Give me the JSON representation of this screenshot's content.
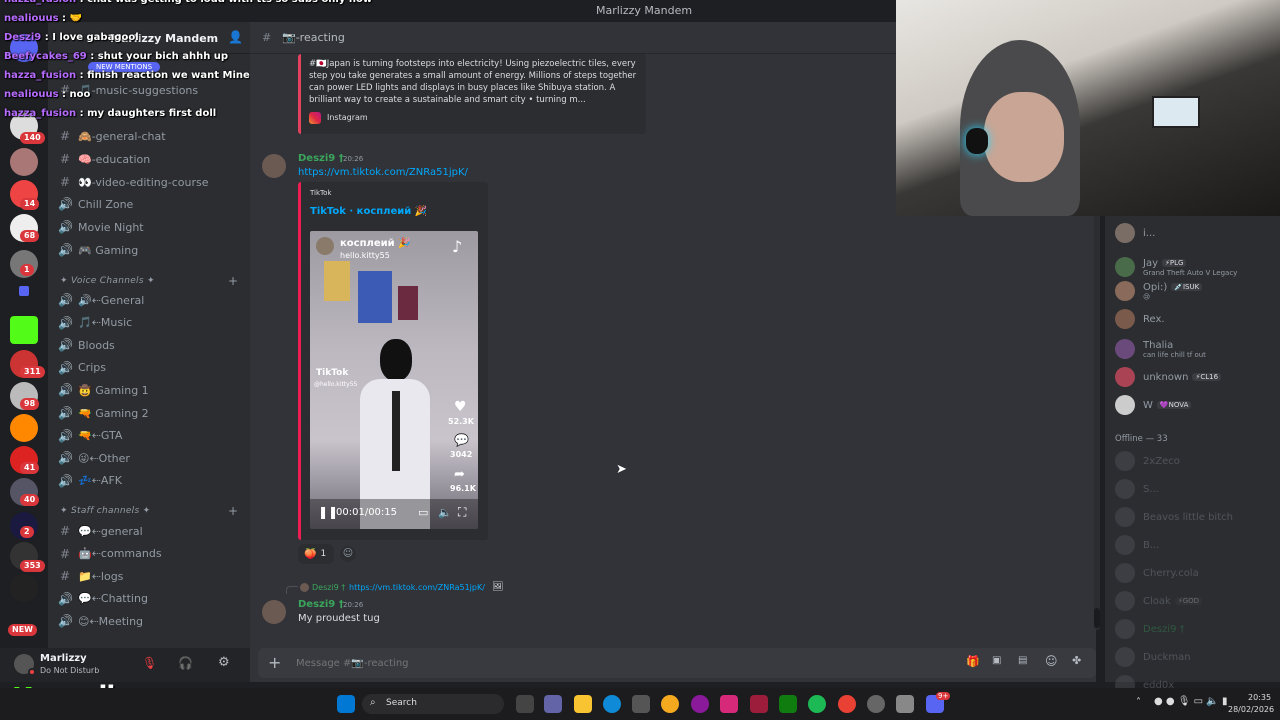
{
  "window": {
    "title": "Marlizzy Mandem"
  },
  "overlay_chat": [
    {
      "user": "hazza_fusion",
      "text": "chat was getting to loud with tts so subs only now"
    },
    {
      "user": "nealiouus",
      "text": "🤝"
    },
    {
      "user": "Deszi9",
      "text": "I love gabagool"
    },
    {
      "user": "Beefycakes_69",
      "text": "shut your bich ahhh up"
    },
    {
      "user": "hazza_fusion",
      "text": "finish reaction we want Minecraft"
    },
    {
      "user": "nealiouus",
      "text": "noo"
    },
    {
      "user": "hazza_fusion",
      "text": "my daughters first doll"
    }
  ],
  "guilds": {
    "badges": [
      "140",
      "14",
      "68",
      "1",
      "311",
      "98",
      "41",
      "40",
      "2",
      "353"
    ],
    "new_label": "NEW"
  },
  "sidebar": {
    "server_name": "Marlizzy Mandem",
    "new_mentions": "NEW MENTIONS",
    "text_channels": [
      {
        "icon": "#",
        "label": "🎵-music-suggestions"
      },
      {
        "icon": "#",
        "label": "🙈-general-chat"
      },
      {
        "icon": "#",
        "label": "🧠-education"
      },
      {
        "icon": "#",
        "label": "👀-video-editing-course"
      },
      {
        "icon": "🔊",
        "label": "Chill Zone"
      },
      {
        "icon": "🔊",
        "label": "Movie Night"
      },
      {
        "icon": "🔊",
        "label": "🎮 Gaming"
      }
    ],
    "voice_category": "✦ Voice Channels ✦",
    "voice_channels": [
      {
        "label": "🔊⇠General"
      },
      {
        "label": "🎵⇠Music"
      },
      {
        "label": "Bloods"
      },
      {
        "label": "Crips"
      },
      {
        "label": "🤠 Gaming 1"
      },
      {
        "label": "🔫 Gaming 2"
      },
      {
        "label": "🔫⇠GTA"
      },
      {
        "label": "😜⇠Other"
      },
      {
        "label": "💤⇠AFK"
      }
    ],
    "staff_category": "✦ Staff channels ✦",
    "staff_channels": [
      {
        "icon": "#",
        "label": "💬⇠general"
      },
      {
        "icon": "#",
        "label": "🤖⇠commands"
      },
      {
        "icon": "#",
        "label": "📁⇠logs"
      },
      {
        "icon": "🔊",
        "label": "💬⇠Chatting"
      },
      {
        "icon": "🔊",
        "label": "😊⇠Meeting"
      }
    ]
  },
  "user_panel": {
    "name": "Marlizzy",
    "status": "Do Not Disturb"
  },
  "channel_header": {
    "name": "📷-reacting"
  },
  "messages": {
    "embed_top": {
      "text": "#🇯🇵Japan is turning footsteps into electricity! Using piezoelectric tiles, every step you take generates a small amount of energy. Millions of steps together can power LED lights and displays in busy places like Shibuya station. A brilliant way to create a sustainable and smart city • turning m...",
      "source": "Instagram"
    },
    "msg1": {
      "author": "Deszi9 †",
      "time": "20:26",
      "link": "https://vm.tiktok.com/ZNRa51jpK/",
      "embed_provider": "TikTok",
      "embed_title": "TikTok · косплеий 🎉",
      "video_caption": "косплеий 🎉",
      "video_user": "hello.kitty55",
      "watermark": "TikTok",
      "watermark_user": "@hello.kitty55",
      "likes": "52.3K",
      "comments": "3042",
      "shares": "96.1K",
      "time_display": "00:01/00:15",
      "reaction": {
        "emoji": "🍑",
        "count": "1"
      }
    },
    "msg2": {
      "reply_author": "Deszi9 †",
      "reply_link": "https://vm.tiktok.com/ZNRa51jpK/",
      "author": "Deszi9 †",
      "time": "20:26",
      "text": "My proudest tug"
    }
  },
  "composer": {
    "placeholder": "Message #📷-reacting"
  },
  "members": {
    "online": [
      {
        "name": "i..."
      },
      {
        "name": "Jay",
        "tag": "⚡PLG",
        "status": "Grand Theft Auto V Legacy"
      },
      {
        "name": "Opi:)",
        "tag": "💉ISUK",
        "status": "😢"
      },
      {
        "name": "Rex."
      },
      {
        "name": "Thalia",
        "status": "can life chill tf out"
      },
      {
        "name": "unknown",
        "tag": "⚡CL16"
      },
      {
        "name": "W",
        "tag": "💜NOVA"
      }
    ],
    "offline_header": "Offline — 33",
    "offline": [
      {
        "name": "2xZeco"
      },
      {
        "name": "S..."
      },
      {
        "name": "Beavos little bitch"
      },
      {
        "name": "B..."
      },
      {
        "name": "Cherry.cola"
      },
      {
        "name": "Cloak",
        "tag": "⚡GOD"
      },
      {
        "name": "Deszi9 †"
      },
      {
        "name": "Duckman"
      },
      {
        "name": "edd0x"
      }
    ]
  },
  "logo": {
    "letter": "K",
    "name": "marlizzy"
  },
  "taskbar": {
    "search": "Search",
    "time": "20:35",
    "date": "28/02/2026",
    "discord_badge": "9+"
  },
  "colors": {
    "accent": "#5865f2",
    "link": "#00a8fc",
    "author": "#3ba55c",
    "dnd": "#f23f43",
    "kick": "#53fc18"
  }
}
